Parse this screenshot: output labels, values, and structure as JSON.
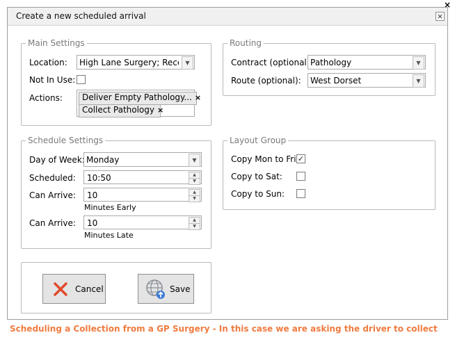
{
  "dialog": {
    "title": "Create a new scheduled arrival",
    "close_glyph": "×"
  },
  "outer_close_glyph": "×",
  "main_settings": {
    "legend": "Main Settings",
    "location_label": "Location:",
    "location_value": "High Lane Surgery; Reception",
    "not_in_use_label": "Not In Use:",
    "not_in_use_checked": false,
    "actions_label": "Actions:",
    "actions": [
      {
        "label": "Deliver Empty Pathology...",
        "remove": "×"
      },
      {
        "label": "Collect Pathology",
        "remove": "×"
      }
    ]
  },
  "routing": {
    "legend": "Routing",
    "contract_label": "Contract (optional):",
    "contract_value": "Pathology",
    "route_label": "Route (optional):",
    "route_value": "West Dorset"
  },
  "schedule_settings": {
    "legend": "Schedule Settings",
    "day_label": "Day of Week:",
    "day_value": "Monday",
    "scheduled_label": "Scheduled:",
    "scheduled_value": "10:50",
    "can_arrive_early_label": "Can Arrive:",
    "can_arrive_early_value": "10",
    "early_caption": "Minutes Early",
    "can_arrive_late_label": "Can Arrive:",
    "can_arrive_late_value": "10",
    "late_caption": "Minutes Late"
  },
  "layout_group": {
    "legend": "Layout Group",
    "copy_mon_fri_label": "Copy Mon to Fri:",
    "copy_mon_fri_checked": true,
    "copy_sat_label": "Copy to Sat:",
    "copy_sat_checked": false,
    "copy_sun_label": "Copy to Sun:",
    "copy_sun_checked": false
  },
  "buttons": {
    "cancel": "Cancel",
    "save": "Save"
  },
  "caption": "Scheduling a Collection from a GP Surgery - In this case we are asking the driver to collect",
  "icons": {
    "dropdown": "chevron-down-icon",
    "spin_up": "chevron-up-icon",
    "check": "check-icon",
    "cancel": "x-icon",
    "save": "globe-upload-icon"
  },
  "colors": {
    "caption": "#f07b3f",
    "cancel_icon": "#e04a2a",
    "save_globe": "#8a8f96",
    "save_upload": "#3c7ad6"
  }
}
